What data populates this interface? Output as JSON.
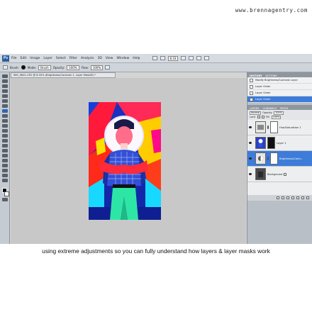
{
  "watermark": "www.brennagentry.com",
  "app": {
    "logo": "Ps"
  },
  "menubar": {
    "items": [
      "File",
      "Edit",
      "Image",
      "Layer",
      "Select",
      "Filter",
      "Analysis",
      "3D",
      "View",
      "Window",
      "Help"
    ],
    "zoom": "8.33"
  },
  "options": {
    "brush_label": "Brush:",
    "mode_label": "Mode:",
    "mode_value": "Brush",
    "opacity_label": "Opacity:",
    "opacity_value": "100%",
    "flow_label": "Flow:",
    "flow_value": "100%"
  },
  "document": {
    "tab_title": "IMG_9841.CR2 @ 8.33% (Brightness/Contrast 1, Layer Mask/8) *"
  },
  "panels": {
    "history_tabs": [
      "HISTORY",
      "ACTIONS"
    ],
    "history": [
      "Modify Brightness/Contrast Layer",
      "Layer Order",
      "Layer Order",
      "Layer Order"
    ],
    "history_selected": 3,
    "layers_tabs": [
      "LAYERS",
      "CHANNELS",
      "PATHS"
    ],
    "blend_mode": "Normal",
    "opacity_label": "Opacity:",
    "opacity_value": "100%",
    "lock_label": "Lock:",
    "fill_label": "Fill:",
    "fill_value": "100%",
    "layers": [
      {
        "name": "Hue/Saturation 1",
        "kind": "adjustment",
        "selected": false
      },
      {
        "name": "Layer 1",
        "kind": "pixel",
        "selected": false
      },
      {
        "name": "Brightness/Contr...",
        "kind": "adjustment",
        "selected": true
      },
      {
        "name": "Background",
        "kind": "pixel",
        "selected": false
      }
    ]
  },
  "caption": "using extreme adjustments so you can fully understand how layers & layer masks work",
  "colors": {
    "panel_selected": "#3d7cd9",
    "menubar_bg": "#d6dbe2",
    "canvas_bg": "#c8c8c8"
  }
}
